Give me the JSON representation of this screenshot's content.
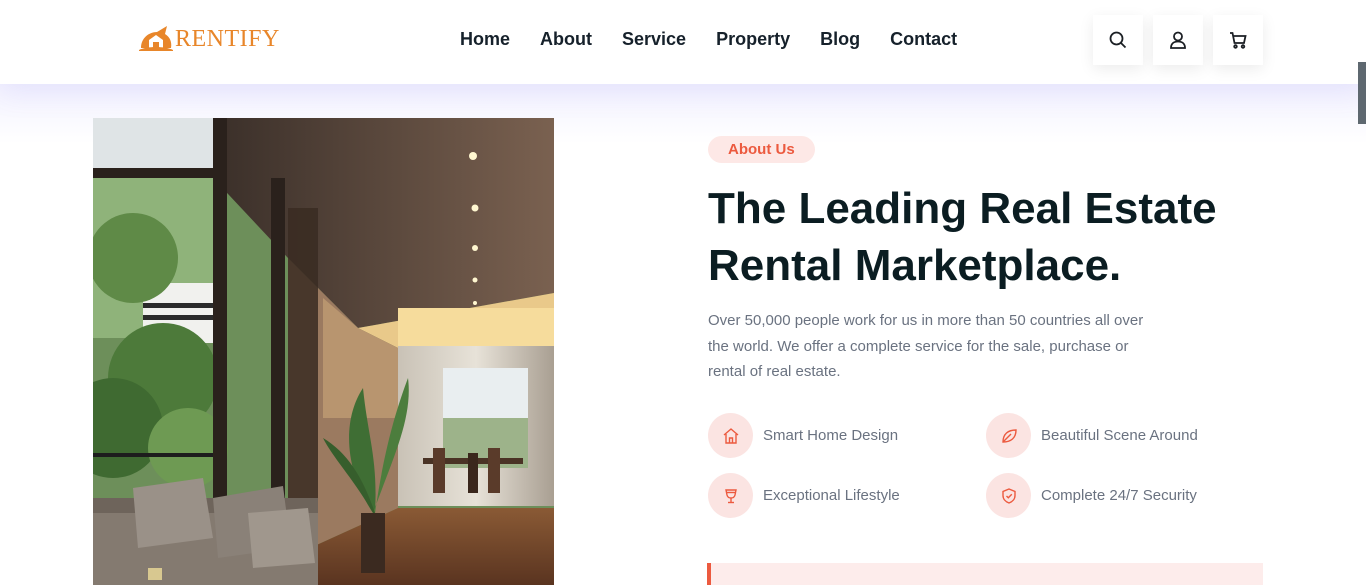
{
  "brand": {
    "name": "RENTIFY",
    "color": "#e8862a"
  },
  "nav": {
    "items": [
      "Home",
      "About",
      "Service",
      "Property",
      "Blog",
      "Contact"
    ]
  },
  "header_actions": [
    {
      "icon": "search-icon"
    },
    {
      "icon": "user-icon"
    },
    {
      "icon": "cart-icon"
    }
  ],
  "about": {
    "badge": "About Us",
    "title": "The Leading Real Estate Rental Marketplace.",
    "description": "Over 50,000 people work for us in more than 50 countries all over the world. We offer a complete service for the sale, purchase or rental of real estate.",
    "features": [
      {
        "icon": "home-icon",
        "label": "Smart Home Design"
      },
      {
        "icon": "leaf-icon",
        "label": "Beautiful Scene Around"
      },
      {
        "icon": "cup-icon",
        "label": "Exceptional Lifestyle"
      },
      {
        "icon": "shield-icon",
        "label": "Complete 24/7 Security"
      }
    ]
  },
  "colors": {
    "accent": "#ec5a3f",
    "badge_bg": "#fde8e6",
    "heading": "#0b1d22",
    "text": "#6a7280"
  }
}
